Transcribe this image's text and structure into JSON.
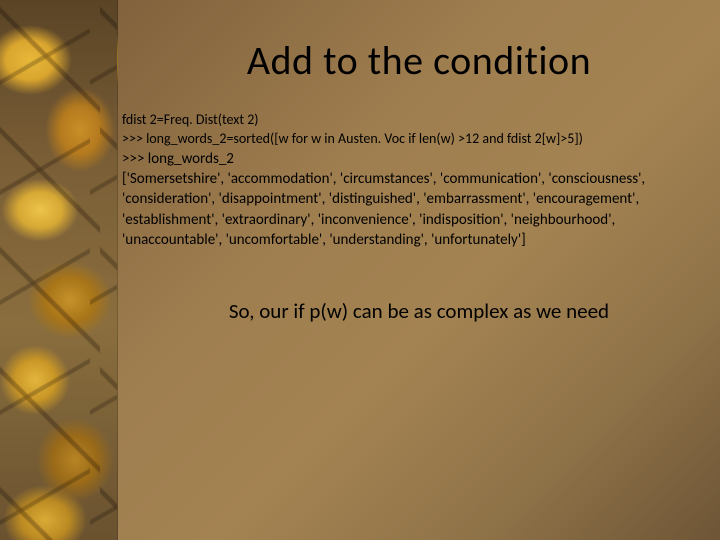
{
  "title": "Add to the condition",
  "code": {
    "line1": "fdist 2=Freq. Dist(text 2)",
    "line2": ">>> long_words_2=sorted([w for w in Austen. Voc if len(w) >12 and fdist 2[w]>5])",
    "line3": ">>> long_words_2",
    "line4": "['Somersetshire', 'accommodation', 'circumstances', 'communication', 'consciousness', 'consideration', 'disappointment', 'distinguished', 'embarrassment', 'encouragement', 'establishment', 'extraordinary', 'inconvenience', 'indisposition', 'neighbourhood', 'unaccountable', 'uncomfortable', 'understanding', 'unfortunately']"
  },
  "conclusion": "So, our if p(w) can be as complex as we need"
}
